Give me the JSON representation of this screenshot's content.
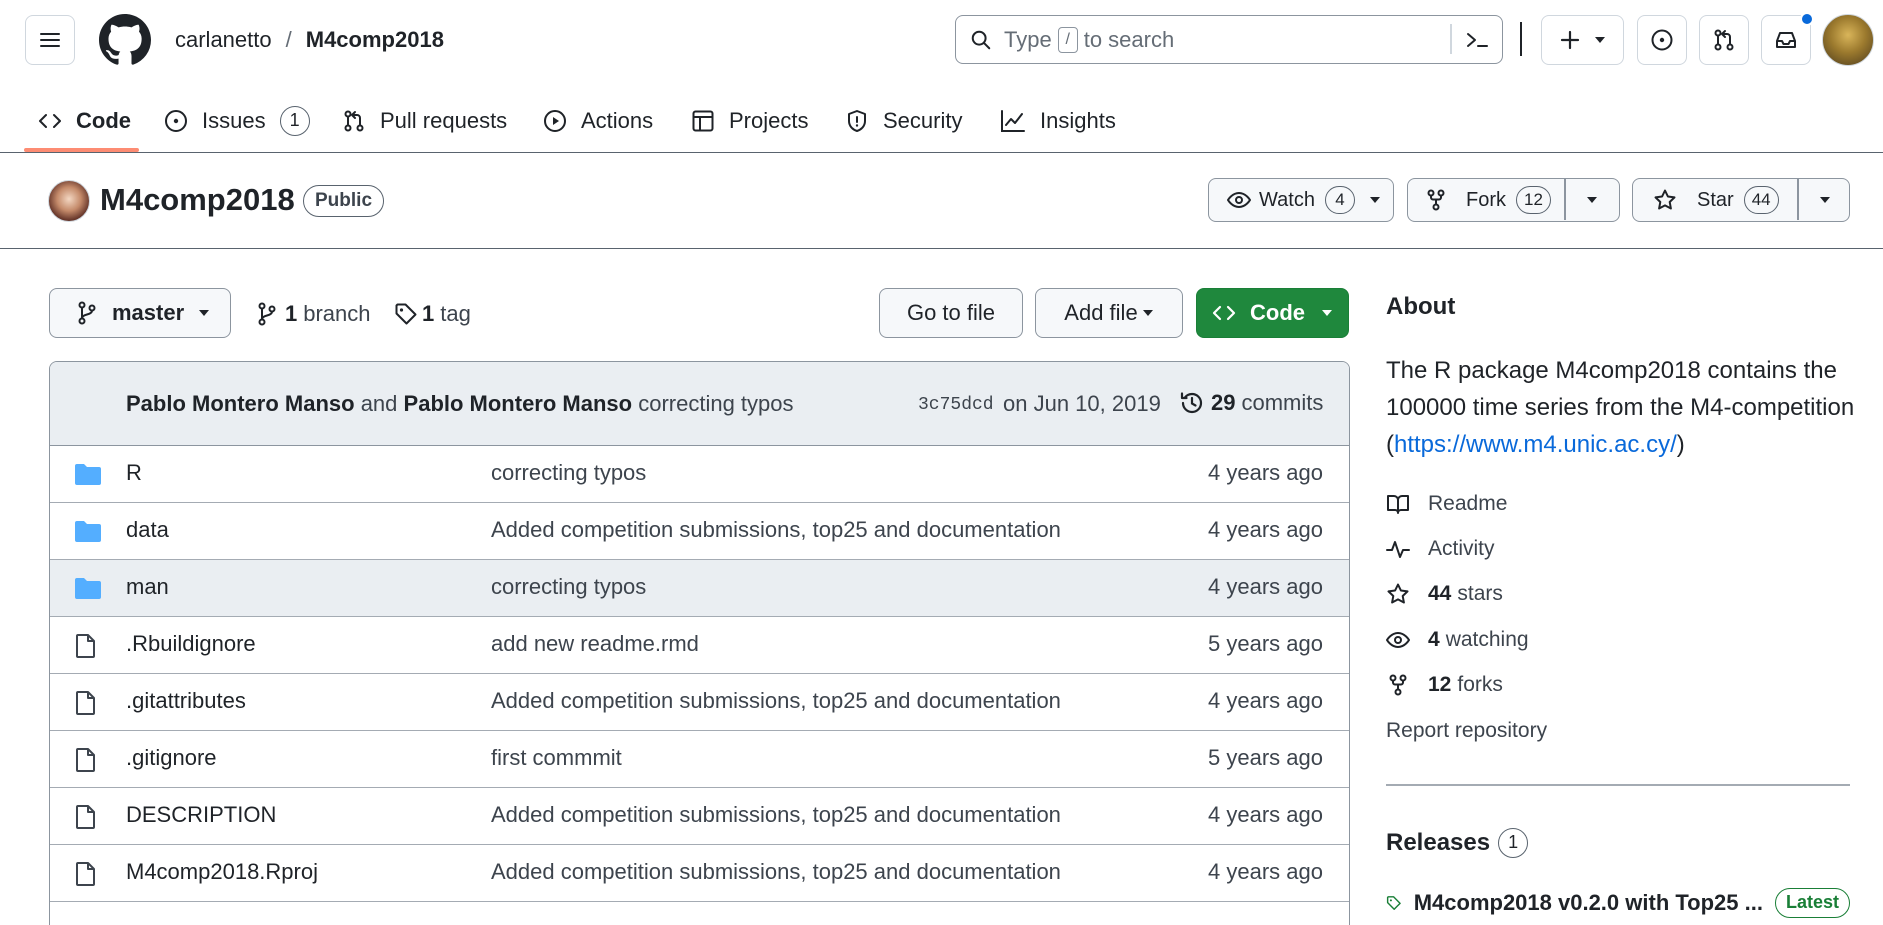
{
  "header": {
    "owner": "carlanetto",
    "separator": "/",
    "repo": "M4comp2018",
    "search_prefix": "Type",
    "search_key": "/",
    "search_suffix": "to search"
  },
  "nav": {
    "tabs": [
      {
        "label": "Code",
        "icon": "code-icon",
        "active": true
      },
      {
        "label": "Issues",
        "icon": "issue-icon",
        "count": "1"
      },
      {
        "label": "Pull requests",
        "icon": "pull-request-icon"
      },
      {
        "label": "Actions",
        "icon": "play-icon"
      },
      {
        "label": "Projects",
        "icon": "table-icon"
      },
      {
        "label": "Security",
        "icon": "shield-icon"
      },
      {
        "label": "Insights",
        "icon": "graph-icon"
      }
    ]
  },
  "repo_head": {
    "name": "M4comp2018",
    "visibility": "Public",
    "watch_label": "Watch",
    "watch_count": "4",
    "fork_label": "Fork",
    "fork_count": "12",
    "star_label": "Star",
    "star_count": "44"
  },
  "toolbar": {
    "branch": "master",
    "branches_count": "1",
    "branches_label": "branch",
    "tags_count": "1",
    "tags_label": "tag",
    "go_to_file": "Go to file",
    "add_file": "Add file",
    "code": "Code"
  },
  "commit": {
    "author1": "Pablo Montero Manso",
    "and": "and",
    "author2": "Pablo Montero Manso",
    "message": "correcting typos",
    "sha": "3c75dcd",
    "date": "on Jun 10, 2019",
    "commits_count": "29",
    "commits_label": "commits"
  },
  "files": [
    {
      "type": "folder",
      "name": "R",
      "message": "correcting typos",
      "age": "4 years ago"
    },
    {
      "type": "folder",
      "name": "data",
      "message": "Added competition submissions, top25 and documentation",
      "age": "4 years ago"
    },
    {
      "type": "folder",
      "name": "man",
      "message": "correcting typos",
      "age": "4 years ago",
      "highlighted": true
    },
    {
      "type": "file",
      "name": ".Rbuildignore",
      "message": "add new readme.rmd",
      "age": "5 years ago"
    },
    {
      "type": "file",
      "name": ".gitattributes",
      "message": "Added competition submissions, top25 and documentation",
      "age": "4 years ago"
    },
    {
      "type": "file",
      "name": ".gitignore",
      "message": "first commmit",
      "age": "5 years ago"
    },
    {
      "type": "file",
      "name": "DESCRIPTION",
      "message": "Added competition submissions, top25 and documentation",
      "age": "4 years ago"
    },
    {
      "type": "file",
      "name": "M4comp2018.Rproj",
      "message": "Added competition submissions, top25 and documentation",
      "age": "4 years ago"
    }
  ],
  "about": {
    "heading": "About",
    "description": "The R package M4comp2018 contains the 100000 time series from the M4-competition (",
    "link": "https://www.m4.unic.ac.cy/",
    "description_end": ")",
    "readme": "Readme",
    "activity": "Activity",
    "stars_count": "44",
    "stars_label": "stars",
    "watching_count": "4",
    "watching_label": "watching",
    "forks_count": "12",
    "forks_label": "forks",
    "report": "Report repository"
  },
  "releases": {
    "heading": "Releases",
    "count": "1",
    "latest_name": "M4comp2018 v0.2.0 with Top25 ...",
    "latest_badge": "Latest"
  },
  "colors": {
    "accent": "#0969da",
    "code_button": "#1f883d",
    "folder": "#54aeff",
    "tab_underline": "#fd8c73",
    "latest_badge": "#1a7f37"
  }
}
